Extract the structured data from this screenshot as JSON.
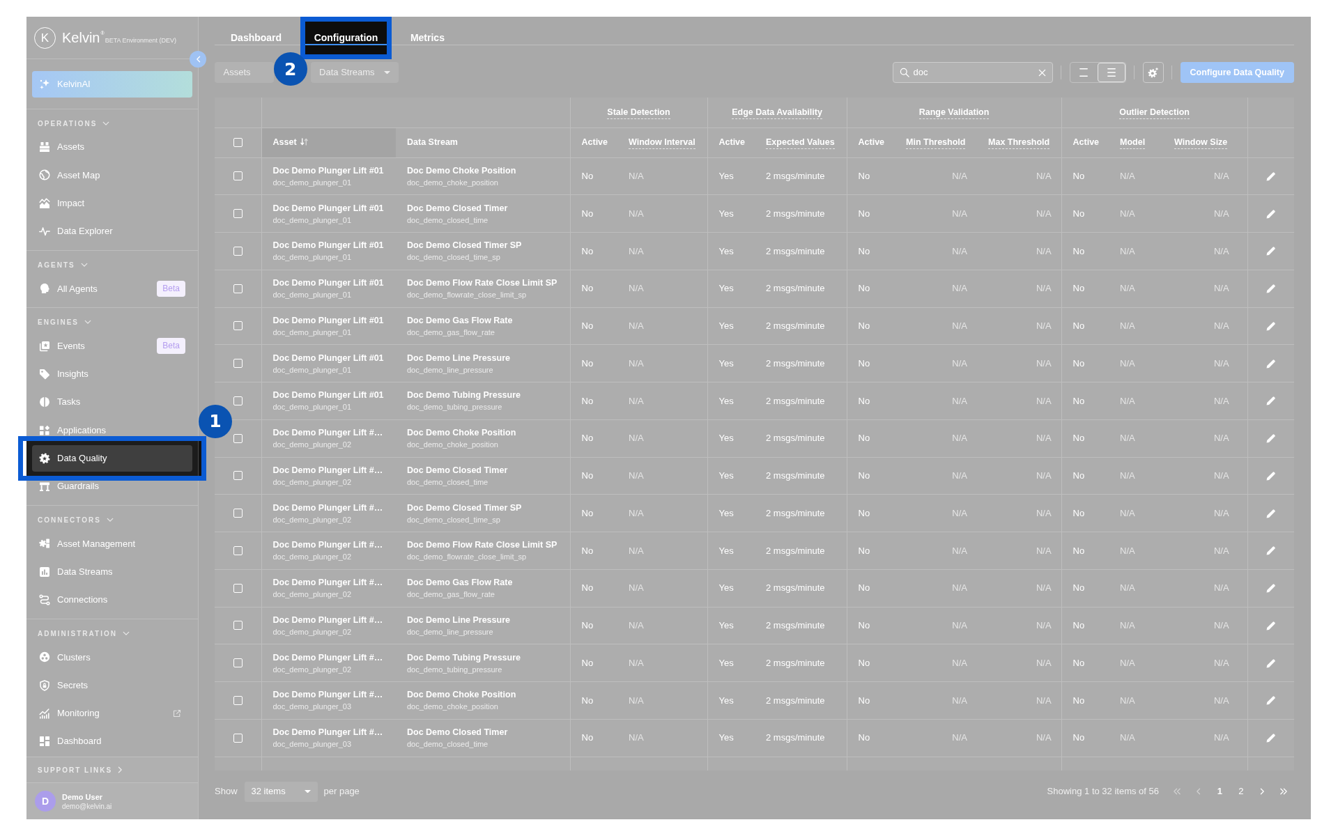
{
  "sidebar": {
    "brand": {
      "mark": "K",
      "name": "Kelvin$^{®}$",
      "environment": "BETA Environment (DEV)"
    },
    "ai_button": {
      "label": "KelvinAI"
    },
    "sections": [
      {
        "title": "OPERATIONS",
        "expanded": true,
        "items": [
          {
            "label": "Assets",
            "selected": false
          },
          {
            "label": "Asset Map",
            "selected": false
          },
          {
            "label": "Impact",
            "selected": false
          },
          {
            "label": "Data Explorer",
            "selected": false
          }
        ]
      },
      {
        "title": "AGENTS",
        "expanded": true,
        "items": [
          {
            "label": "All Agents",
            "selected": false,
            "badge": "Beta"
          }
        ]
      },
      {
        "title": "ENGINES",
        "expanded": true,
        "items": [
          {
            "label": "Events",
            "selected": false,
            "badge": "Beta"
          },
          {
            "label": "Insights",
            "selected": false
          },
          {
            "label": "Tasks",
            "selected": false
          },
          {
            "label": "Applications",
            "selected": false
          },
          {
            "label": "Data Quality",
            "selected": true,
            "callout": "1"
          },
          {
            "label": "Guardrails",
            "selected": false
          }
        ]
      },
      {
        "title": "CONNECTORS",
        "expanded": true,
        "items": [
          {
            "label": "Asset Management",
            "selected": false
          },
          {
            "label": "Data Streams",
            "selected": false
          },
          {
            "label": "Connections",
            "selected": false
          }
        ]
      },
      {
        "title": "ADMINISTRATION",
        "expanded": true,
        "items": [
          {
            "label": "Clusters",
            "selected": false
          },
          {
            "label": "Secrets",
            "selected": false
          },
          {
            "label": "Monitoring",
            "selected": false,
            "external": true
          },
          {
            "label": "Dashboard",
            "selected": false
          }
        ]
      }
    ],
    "support": {
      "title": "SUPPORT LINKS",
      "expanded": false
    },
    "user": {
      "initial": "D",
      "name": "Demo User",
      "email": "demo@kelvin.ai"
    }
  },
  "tabs": [
    {
      "label": "Dashboard",
      "selected": false
    },
    {
      "label": "Configuration",
      "selected": true,
      "callout": "2"
    },
    {
      "label": "Metrics",
      "selected": false
    }
  ],
  "toolbar": {
    "filters": [
      {
        "placeholder": "Assets"
      },
      {
        "placeholder": "Data Streams",
        "caret": true
      }
    ],
    "search": {
      "value": "doc"
    },
    "density_options": [
      {
        "selected": false
      },
      {
        "selected": true
      }
    ],
    "primary_button": {
      "label": "Configure Data Quality"
    }
  },
  "table": {
    "select_all": {
      "checked": false
    },
    "columns": [
      {
        "label": "Asset",
        "sorted": true
      },
      {
        "label": "Data Stream",
        "sorted": false
      }
    ],
    "groups": [
      {
        "label": "Stale Detection",
        "hint": true,
        "columns": [
          {
            "label": "Active",
            "hint": false
          },
          {
            "label": "Window Interval",
            "hint": true
          }
        ]
      },
      {
        "label": "Edge Data Availability",
        "hint": true,
        "columns": [
          {
            "label": "Active",
            "hint": false
          },
          {
            "label": "Expected Values",
            "hint": true
          }
        ]
      },
      {
        "label": "Range Validation",
        "hint": true,
        "columns": [
          {
            "label": "Active",
            "hint": false
          },
          {
            "label": "Min Threshold",
            "hint": true
          },
          {
            "label": "Max Threshold",
            "hint": true
          }
        ]
      },
      {
        "label": "Outlier Detection",
        "hint": true,
        "columns": [
          {
            "label": "Active",
            "hint": false
          },
          {
            "label": "Model",
            "hint": true
          },
          {
            "label": "Window Size",
            "hint": true
          }
        ]
      }
    ],
    "rows": [
      {
        "checked": false,
        "asset": "Doc Demo Plunger Lift #01",
        "asset_id": "doc_demo_plunger_01",
        "stream": "Doc Demo Choke Position",
        "stream_id": "doc_demo_choke_position",
        "checks": [
          {
            "active": false,
            "status": "No",
            "values": [
              "N/A"
            ]
          },
          {
            "active": true,
            "status": "Yes",
            "values": [
              "2 msgs/minute"
            ]
          },
          {
            "active": false,
            "status": "No",
            "values": [
              "N/A",
              "N/A"
            ]
          },
          {
            "active": false,
            "status": "No",
            "values": [
              "N/A",
              "N/A"
            ]
          }
        ]
      },
      {
        "checked": false,
        "asset": "Doc Demo Plunger Lift #01",
        "asset_id": "doc_demo_plunger_01",
        "stream": "Doc Demo Closed Timer",
        "stream_id": "doc_demo_closed_time",
        "checks": [
          {
            "active": false,
            "status": "No",
            "values": [
              "N/A"
            ]
          },
          {
            "active": true,
            "status": "Yes",
            "values": [
              "2 msgs/minute"
            ]
          },
          {
            "active": false,
            "status": "No",
            "values": [
              "N/A",
              "N/A"
            ]
          },
          {
            "active": false,
            "status": "No",
            "values": [
              "N/A",
              "N/A"
            ]
          }
        ]
      },
      {
        "checked": false,
        "asset": "Doc Demo Plunger Lift #01",
        "asset_id": "doc_demo_plunger_01",
        "stream": "Doc Demo Closed Timer SP",
        "stream_id": "doc_demo_closed_time_sp",
        "checks": [
          {
            "active": false,
            "status": "No",
            "values": [
              "N/A"
            ]
          },
          {
            "active": true,
            "status": "Yes",
            "values": [
              "2 msgs/minute"
            ]
          },
          {
            "active": false,
            "status": "No",
            "values": [
              "N/A",
              "N/A"
            ]
          },
          {
            "active": false,
            "status": "No",
            "values": [
              "N/A",
              "N/A"
            ]
          }
        ]
      },
      {
        "checked": false,
        "asset": "Doc Demo Plunger Lift #01",
        "asset_id": "doc_demo_plunger_01",
        "stream": "Doc Demo Flow Rate Close Limit SP",
        "stream_id": "doc_demo_flowrate_close_limit_sp",
        "checks": [
          {
            "active": false,
            "status": "No",
            "values": [
              "N/A"
            ]
          },
          {
            "active": true,
            "status": "Yes",
            "values": [
              "2 msgs/minute"
            ]
          },
          {
            "active": false,
            "status": "No",
            "values": [
              "N/A",
              "N/A"
            ]
          },
          {
            "active": false,
            "status": "No",
            "values": [
              "N/A",
              "N/A"
            ]
          }
        ]
      },
      {
        "checked": false,
        "asset": "Doc Demo Plunger Lift #01",
        "asset_id": "doc_demo_plunger_01",
        "stream": "Doc Demo Gas Flow Rate",
        "stream_id": "doc_demo_gas_flow_rate",
        "checks": [
          {
            "active": false,
            "status": "No",
            "values": [
              "N/A"
            ]
          },
          {
            "active": true,
            "status": "Yes",
            "values": [
              "2 msgs/minute"
            ]
          },
          {
            "active": false,
            "status": "No",
            "values": [
              "N/A",
              "N/A"
            ]
          },
          {
            "active": false,
            "status": "No",
            "values": [
              "N/A",
              "N/A"
            ]
          }
        ]
      },
      {
        "checked": false,
        "asset": "Doc Demo Plunger Lift #01",
        "asset_id": "doc_demo_plunger_01",
        "stream": "Doc Demo Line Pressure",
        "stream_id": "doc_demo_line_pressure",
        "checks": [
          {
            "active": false,
            "status": "No",
            "values": [
              "N/A"
            ]
          },
          {
            "active": true,
            "status": "Yes",
            "values": [
              "2 msgs/minute"
            ]
          },
          {
            "active": false,
            "status": "No",
            "values": [
              "N/A",
              "N/A"
            ]
          },
          {
            "active": false,
            "status": "No",
            "values": [
              "N/A",
              "N/A"
            ]
          }
        ]
      },
      {
        "checked": false,
        "asset": "Doc Demo Plunger Lift #01",
        "asset_id": "doc_demo_plunger_01",
        "stream": "Doc Demo Tubing Pressure",
        "stream_id": "doc_demo_tubing_pressure",
        "checks": [
          {
            "active": false,
            "status": "No",
            "values": [
              "N/A"
            ]
          },
          {
            "active": true,
            "status": "Yes",
            "values": [
              "2 msgs/minute"
            ]
          },
          {
            "active": false,
            "status": "No",
            "values": [
              "N/A",
              "N/A"
            ]
          },
          {
            "active": false,
            "status": "No",
            "values": [
              "N/A",
              "N/A"
            ]
          }
        ]
      },
      {
        "checked": false,
        "asset": "Doc Demo Plunger Lift #…",
        "asset_id": "doc_demo_plunger_02",
        "stream": "Doc Demo Choke Position",
        "stream_id": "doc_demo_choke_position",
        "checks": [
          {
            "active": false,
            "status": "No",
            "values": [
              "N/A"
            ]
          },
          {
            "active": true,
            "status": "Yes",
            "values": [
              "2 msgs/minute"
            ]
          },
          {
            "active": false,
            "status": "No",
            "values": [
              "N/A",
              "N/A"
            ]
          },
          {
            "active": false,
            "status": "No",
            "values": [
              "N/A",
              "N/A"
            ]
          }
        ]
      },
      {
        "checked": false,
        "asset": "Doc Demo Plunger Lift #…",
        "asset_id": "doc_demo_plunger_02",
        "stream": "Doc Demo Closed Timer",
        "stream_id": "doc_demo_closed_time",
        "checks": [
          {
            "active": false,
            "status": "No",
            "values": [
              "N/A"
            ]
          },
          {
            "active": true,
            "status": "Yes",
            "values": [
              "2 msgs/minute"
            ]
          },
          {
            "active": false,
            "status": "No",
            "values": [
              "N/A",
              "N/A"
            ]
          },
          {
            "active": false,
            "status": "No",
            "values": [
              "N/A",
              "N/A"
            ]
          }
        ]
      },
      {
        "checked": false,
        "asset": "Doc Demo Plunger Lift #…",
        "asset_id": "doc_demo_plunger_02",
        "stream": "Doc Demo Closed Timer SP",
        "stream_id": "doc_demo_closed_time_sp",
        "checks": [
          {
            "active": false,
            "status": "No",
            "values": [
              "N/A"
            ]
          },
          {
            "active": true,
            "status": "Yes",
            "values": [
              "2 msgs/minute"
            ]
          },
          {
            "active": false,
            "status": "No",
            "values": [
              "N/A",
              "N/A"
            ]
          },
          {
            "active": false,
            "status": "No",
            "values": [
              "N/A",
              "N/A"
            ]
          }
        ]
      },
      {
        "checked": false,
        "asset": "Doc Demo Plunger Lift #…",
        "asset_id": "doc_demo_plunger_02",
        "stream": "Doc Demo Flow Rate Close Limit SP",
        "stream_id": "doc_demo_flowrate_close_limit_sp",
        "checks": [
          {
            "active": false,
            "status": "No",
            "values": [
              "N/A"
            ]
          },
          {
            "active": true,
            "status": "Yes",
            "values": [
              "2 msgs/minute"
            ]
          },
          {
            "active": false,
            "status": "No",
            "values": [
              "N/A",
              "N/A"
            ]
          },
          {
            "active": false,
            "status": "No",
            "values": [
              "N/A",
              "N/A"
            ]
          }
        ]
      },
      {
        "checked": false,
        "asset": "Doc Demo Plunger Lift #…",
        "asset_id": "doc_demo_plunger_02",
        "stream": "Doc Demo Gas Flow Rate",
        "stream_id": "doc_demo_gas_flow_rate",
        "checks": [
          {
            "active": false,
            "status": "No",
            "values": [
              "N/A"
            ]
          },
          {
            "active": true,
            "status": "Yes",
            "values": [
              "2 msgs/minute"
            ]
          },
          {
            "active": false,
            "status": "No",
            "values": [
              "N/A",
              "N/A"
            ]
          },
          {
            "active": false,
            "status": "No",
            "values": [
              "N/A",
              "N/A"
            ]
          }
        ]
      },
      {
        "checked": false,
        "asset": "Doc Demo Plunger Lift #…",
        "asset_id": "doc_demo_plunger_02",
        "stream": "Doc Demo Line Pressure",
        "stream_id": "doc_demo_line_pressure",
        "checks": [
          {
            "active": false,
            "status": "No",
            "values": [
              "N/A"
            ]
          },
          {
            "active": true,
            "status": "Yes",
            "values": [
              "2 msgs/minute"
            ]
          },
          {
            "active": false,
            "status": "No",
            "values": [
              "N/A",
              "N/A"
            ]
          },
          {
            "active": false,
            "status": "No",
            "values": [
              "N/A",
              "N/A"
            ]
          }
        ]
      },
      {
        "checked": false,
        "asset": "Doc Demo Plunger Lift #…",
        "asset_id": "doc_demo_plunger_02",
        "stream": "Doc Demo Tubing Pressure",
        "stream_id": "doc_demo_tubing_pressure",
        "checks": [
          {
            "active": false,
            "status": "No",
            "values": [
              "N/A"
            ]
          },
          {
            "active": true,
            "status": "Yes",
            "values": [
              "2 msgs/minute"
            ]
          },
          {
            "active": false,
            "status": "No",
            "values": [
              "N/A",
              "N/A"
            ]
          },
          {
            "active": false,
            "status": "No",
            "values": [
              "N/A",
              "N/A"
            ]
          }
        ]
      },
      {
        "checked": false,
        "asset": "Doc Demo Plunger Lift #…",
        "asset_id": "doc_demo_plunger_03",
        "stream": "Doc Demo Choke Position",
        "stream_id": "doc_demo_choke_position",
        "checks": [
          {
            "active": false,
            "status": "No",
            "values": [
              "N/A"
            ]
          },
          {
            "active": true,
            "status": "Yes",
            "values": [
              "2 msgs/minute"
            ]
          },
          {
            "active": false,
            "status": "No",
            "values": [
              "N/A",
              "N/A"
            ]
          },
          {
            "active": false,
            "status": "No",
            "values": [
              "N/A",
              "N/A"
            ]
          }
        ]
      },
      {
        "checked": false,
        "asset": "Doc Demo Plunger Lift #…",
        "asset_id": "doc_demo_plunger_03",
        "stream": "Doc Demo Closed Timer",
        "stream_id": "doc_demo_closed_time",
        "checks": [
          {
            "active": false,
            "status": "No",
            "values": [
              "N/A"
            ]
          },
          {
            "active": true,
            "status": "Yes",
            "values": [
              "2 msgs/minute"
            ]
          },
          {
            "active": false,
            "status": "No",
            "values": [
              "N/A",
              "N/A"
            ]
          },
          {
            "active": false,
            "status": "No",
            "values": [
              "N/A",
              "N/A"
            ]
          }
        ]
      }
    ]
  },
  "footer": {
    "show_label": "Show",
    "page_size": "32 items",
    "per_page_label": "per page",
    "summary": "Showing 1 to 32 items of 56",
    "first": {
      "disabled": true
    },
    "previous": {
      "disabled": true
    },
    "pages": [
      {
        "label": "1",
        "selected": true
      },
      {
        "label": "2",
        "selected": false
      }
    ],
    "next": {
      "disabled": false
    },
    "last": {
      "disabled": false
    }
  }
}
